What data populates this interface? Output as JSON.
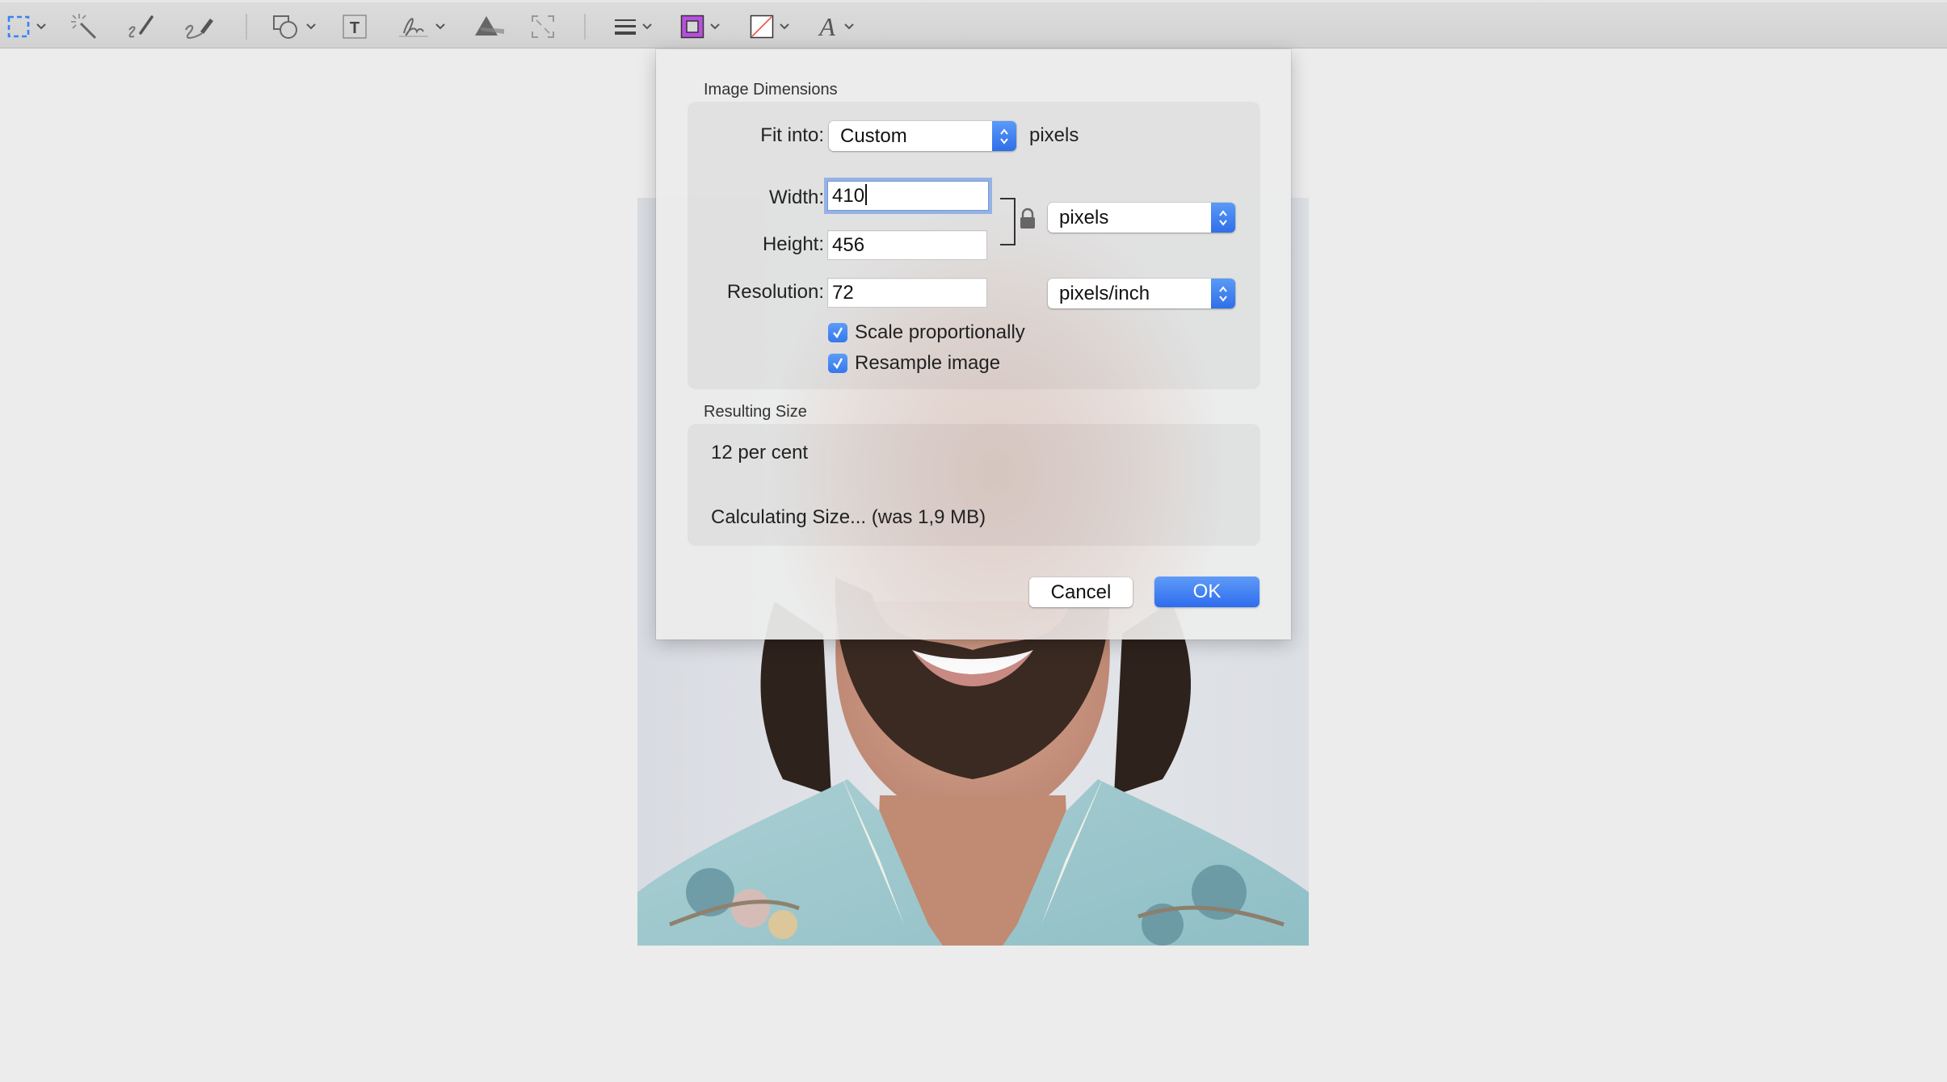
{
  "toolbar": {
    "tools": [
      {
        "id": "rect-selection",
        "icon": "rectangular-selection-icon",
        "has_menu": true
      },
      {
        "id": "instant-alpha",
        "icon": "magic-wand-icon",
        "has_menu": false
      },
      {
        "id": "sketch",
        "icon": "sketch-pen-icon",
        "has_menu": false
      },
      {
        "id": "draw",
        "icon": "draw-marker-icon",
        "has_menu": false
      },
      {
        "id": "shapes",
        "icon": "shapes-icon",
        "has_menu": true
      },
      {
        "id": "text",
        "icon": "text-box-icon",
        "has_menu": false
      },
      {
        "id": "sign",
        "icon": "signature-icon",
        "has_menu": true
      },
      {
        "id": "adjust-color",
        "icon": "adjust-color-prism-icon",
        "has_menu": false
      },
      {
        "id": "adjust-size",
        "icon": "adjust-size-icon",
        "has_menu": false
      },
      {
        "id": "shape-style",
        "icon": "line-style-icon",
        "has_menu": true
      },
      {
        "id": "border-color",
        "icon": "border-color-icon",
        "has_menu": true
      },
      {
        "id": "fill-color",
        "icon": "fill-color-icon",
        "has_menu": true
      },
      {
        "id": "text-style",
        "icon": "text-style-icon",
        "has_menu": true
      }
    ],
    "colors": {
      "selection_accent": "#3b82f6",
      "border_color_swatch": "#b84fe0",
      "fill_none_slash": "#e8584a"
    }
  },
  "dialog": {
    "image_dimensions": {
      "section_title": "Image Dimensions",
      "fit_into_label": "Fit into:",
      "fit_into_value": "Custom",
      "fit_into_suffix": "pixels",
      "width_label": "Width:",
      "width_value": "410",
      "height_label": "Height:",
      "height_value": "456",
      "resolution_label": "Resolution:",
      "resolution_value": "72",
      "size_unit_value": "pixels",
      "resolution_unit_value": "pixels/inch",
      "dimensions_locked": true,
      "scale_proportionally": {
        "label": "Scale proportionally",
        "checked": true
      },
      "resample_image": {
        "label": "Resample image",
        "checked": true
      }
    },
    "resulting_size": {
      "section_title": "Resulting Size",
      "percent_text": "12 per cent",
      "size_text": "Calculating Size... (was 1,9 MB)"
    },
    "buttons": {
      "cancel_label": "Cancel",
      "ok_label": "OK"
    },
    "accent_color": "#3478f6"
  },
  "canvas": {
    "image_description": "portrait photo: bearded man smiling, light blue floral shirt"
  }
}
